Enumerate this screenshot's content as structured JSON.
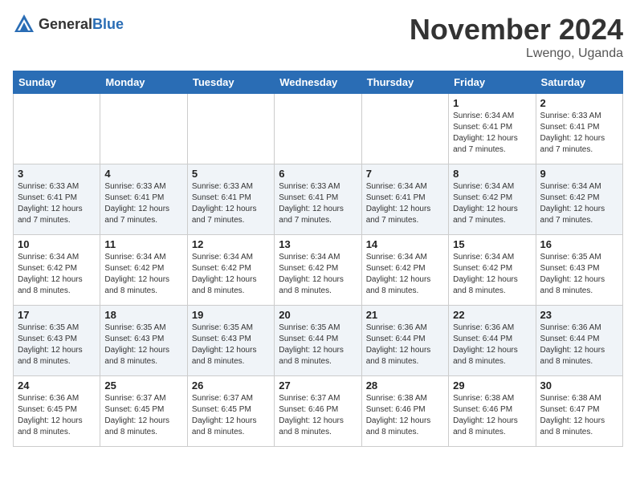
{
  "header": {
    "logo_general": "General",
    "logo_blue": "Blue",
    "month_title": "November 2024",
    "location": "Lwengo, Uganda"
  },
  "days_of_week": [
    "Sunday",
    "Monday",
    "Tuesday",
    "Wednesday",
    "Thursday",
    "Friday",
    "Saturday"
  ],
  "weeks": [
    [
      {
        "day": "",
        "info": ""
      },
      {
        "day": "",
        "info": ""
      },
      {
        "day": "",
        "info": ""
      },
      {
        "day": "",
        "info": ""
      },
      {
        "day": "",
        "info": ""
      },
      {
        "day": "1",
        "info": "Sunrise: 6:34 AM\nSunset: 6:41 PM\nDaylight: 12 hours\nand 7 minutes."
      },
      {
        "day": "2",
        "info": "Sunrise: 6:33 AM\nSunset: 6:41 PM\nDaylight: 12 hours\nand 7 minutes."
      }
    ],
    [
      {
        "day": "3",
        "info": "Sunrise: 6:33 AM\nSunset: 6:41 PM\nDaylight: 12 hours\nand 7 minutes."
      },
      {
        "day": "4",
        "info": "Sunrise: 6:33 AM\nSunset: 6:41 PM\nDaylight: 12 hours\nand 7 minutes."
      },
      {
        "day": "5",
        "info": "Sunrise: 6:33 AM\nSunset: 6:41 PM\nDaylight: 12 hours\nand 7 minutes."
      },
      {
        "day": "6",
        "info": "Sunrise: 6:33 AM\nSunset: 6:41 PM\nDaylight: 12 hours\nand 7 minutes."
      },
      {
        "day": "7",
        "info": "Sunrise: 6:34 AM\nSunset: 6:41 PM\nDaylight: 12 hours\nand 7 minutes."
      },
      {
        "day": "8",
        "info": "Sunrise: 6:34 AM\nSunset: 6:42 PM\nDaylight: 12 hours\nand 7 minutes."
      },
      {
        "day": "9",
        "info": "Sunrise: 6:34 AM\nSunset: 6:42 PM\nDaylight: 12 hours\nand 7 minutes."
      }
    ],
    [
      {
        "day": "10",
        "info": "Sunrise: 6:34 AM\nSunset: 6:42 PM\nDaylight: 12 hours\nand 8 minutes."
      },
      {
        "day": "11",
        "info": "Sunrise: 6:34 AM\nSunset: 6:42 PM\nDaylight: 12 hours\nand 8 minutes."
      },
      {
        "day": "12",
        "info": "Sunrise: 6:34 AM\nSunset: 6:42 PM\nDaylight: 12 hours\nand 8 minutes."
      },
      {
        "day": "13",
        "info": "Sunrise: 6:34 AM\nSunset: 6:42 PM\nDaylight: 12 hours\nand 8 minutes."
      },
      {
        "day": "14",
        "info": "Sunrise: 6:34 AM\nSunset: 6:42 PM\nDaylight: 12 hours\nand 8 minutes."
      },
      {
        "day": "15",
        "info": "Sunrise: 6:34 AM\nSunset: 6:42 PM\nDaylight: 12 hours\nand 8 minutes."
      },
      {
        "day": "16",
        "info": "Sunrise: 6:35 AM\nSunset: 6:43 PM\nDaylight: 12 hours\nand 8 minutes."
      }
    ],
    [
      {
        "day": "17",
        "info": "Sunrise: 6:35 AM\nSunset: 6:43 PM\nDaylight: 12 hours\nand 8 minutes."
      },
      {
        "day": "18",
        "info": "Sunrise: 6:35 AM\nSunset: 6:43 PM\nDaylight: 12 hours\nand 8 minutes."
      },
      {
        "day": "19",
        "info": "Sunrise: 6:35 AM\nSunset: 6:43 PM\nDaylight: 12 hours\nand 8 minutes."
      },
      {
        "day": "20",
        "info": "Sunrise: 6:35 AM\nSunset: 6:44 PM\nDaylight: 12 hours\nand 8 minutes."
      },
      {
        "day": "21",
        "info": "Sunrise: 6:36 AM\nSunset: 6:44 PM\nDaylight: 12 hours\nand 8 minutes."
      },
      {
        "day": "22",
        "info": "Sunrise: 6:36 AM\nSunset: 6:44 PM\nDaylight: 12 hours\nand 8 minutes."
      },
      {
        "day": "23",
        "info": "Sunrise: 6:36 AM\nSunset: 6:44 PM\nDaylight: 12 hours\nand 8 minutes."
      }
    ],
    [
      {
        "day": "24",
        "info": "Sunrise: 6:36 AM\nSunset: 6:45 PM\nDaylight: 12 hours\nand 8 minutes."
      },
      {
        "day": "25",
        "info": "Sunrise: 6:37 AM\nSunset: 6:45 PM\nDaylight: 12 hours\nand 8 minutes."
      },
      {
        "day": "26",
        "info": "Sunrise: 6:37 AM\nSunset: 6:45 PM\nDaylight: 12 hours\nand 8 minutes."
      },
      {
        "day": "27",
        "info": "Sunrise: 6:37 AM\nSunset: 6:46 PM\nDaylight: 12 hours\nand 8 minutes."
      },
      {
        "day": "28",
        "info": "Sunrise: 6:38 AM\nSunset: 6:46 PM\nDaylight: 12 hours\nand 8 minutes."
      },
      {
        "day": "29",
        "info": "Sunrise: 6:38 AM\nSunset: 6:46 PM\nDaylight: 12 hours\nand 8 minutes."
      },
      {
        "day": "30",
        "info": "Sunrise: 6:38 AM\nSunset: 6:47 PM\nDaylight: 12 hours\nand 8 minutes."
      }
    ]
  ]
}
